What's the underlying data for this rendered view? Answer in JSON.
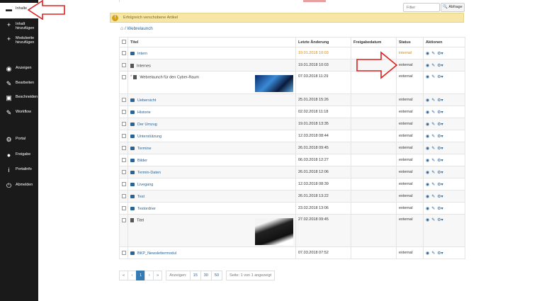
{
  "sidebar": {
    "items": [
      {
        "label": "Inhalte",
        "icon": "folder-icon",
        "active": true
      },
      {
        "label": "Inhalt\nhinzufügen",
        "icon": "plus-icon"
      },
      {
        "label": "Modulseite\nhinzufügen",
        "icon": "plus-icon"
      },
      {
        "label": "Anzeigen",
        "icon": "eye-icon"
      },
      {
        "label": "Bearbeiten",
        "icon": "pencil-icon"
      },
      {
        "label": "Beschneiden",
        "icon": "image-icon"
      },
      {
        "label": "Workflow",
        "icon": "pencil-icon"
      },
      {
        "label": "Portal",
        "icon": "cogs-icon"
      },
      {
        "label": "Freigabe",
        "icon": "users-icon"
      },
      {
        "label": "Portalinfo",
        "icon": "info-icon"
      },
      {
        "label": "Abmelden",
        "icon": "logout-icon"
      }
    ]
  },
  "filter": {
    "placeholder": "Filter",
    "button_label": "Abfrage"
  },
  "alert": {
    "text": "Erfolgreich verschobene Artikel"
  },
  "breadcrumb": {
    "path": "/ Webrelaunch"
  },
  "table": {
    "headers": [
      "Titel",
      "Letzte Änderung",
      "Freigabedatum",
      "Status",
      "Aktionen"
    ],
    "rows": [
      {
        "type": "folder",
        "title": "Intern",
        "modified": "19.01.2018 10:03",
        "release": "",
        "status": "internal"
      },
      {
        "type": "doc",
        "title": "Internes",
        "modified": "19.01.2018 10:03",
        "release": "",
        "status": "external"
      },
      {
        "type": "doc",
        "title": "Webrelaunch für den Cyber-Raum",
        "modified": "07.03.2018 11:29",
        "release": "",
        "status": "external",
        "thumb": "thumb1",
        "starred": true
      },
      {
        "type": "folder",
        "title": "Uebersicht",
        "modified": "25.01.2018 15:26",
        "release": "",
        "status": "external"
      },
      {
        "type": "folder",
        "title": "Historie",
        "modified": "02.02.2018 11:18",
        "release": "",
        "status": "external"
      },
      {
        "type": "folder",
        "title": "Der Umzug",
        "modified": "19.01.2018 13:35",
        "release": "",
        "status": "external"
      },
      {
        "type": "folder",
        "title": "Unterstützung",
        "modified": "12.03.2018 08:44",
        "release": "",
        "status": "external"
      },
      {
        "type": "folder",
        "title": "Termine",
        "modified": "26.01.2018 09:45",
        "release": "",
        "status": "external"
      },
      {
        "type": "folder",
        "title": "Bilder",
        "modified": "06.03.2018 12:27",
        "release": "",
        "status": "external"
      },
      {
        "type": "folder",
        "title": "Termin-Daten",
        "modified": "26.01.2018 12:06",
        "release": "",
        "status": "external"
      },
      {
        "type": "folder",
        "title": "Livegang",
        "modified": "12.03.2018 08:39",
        "release": "",
        "status": "external"
      },
      {
        "type": "folder",
        "title": "Test",
        "modified": "26.01.2018 13:22",
        "release": "",
        "status": "external"
      },
      {
        "type": "folder",
        "title": "Testordner",
        "modified": "23.02.2018 13:06",
        "release": "",
        "status": "external"
      },
      {
        "type": "doc",
        "title": "Titel",
        "modified": "27.02.2018 09:45",
        "release": "",
        "status": "external",
        "thumb": "thumb2"
      },
      {
        "type": "folder",
        "title": "BKP_Newslettermodul",
        "modified": "07.03.2018 07:52",
        "release": "",
        "status": "external"
      }
    ]
  },
  "pager": {
    "first": "«",
    "prev": "‹",
    "current": "1",
    "next": "›",
    "last": "»",
    "show_label": "Anzeigen:",
    "sizes": [
      "15",
      "30",
      "50"
    ],
    "summary": "Seite: 1 von 1 angezeigt"
  },
  "colors": {
    "sidebar": "#1a1a1a",
    "link": "#2a6496",
    "alert_bg": "#f7e7a6",
    "warn": "#e08a00",
    "annotation_arrow": "#e02020"
  }
}
